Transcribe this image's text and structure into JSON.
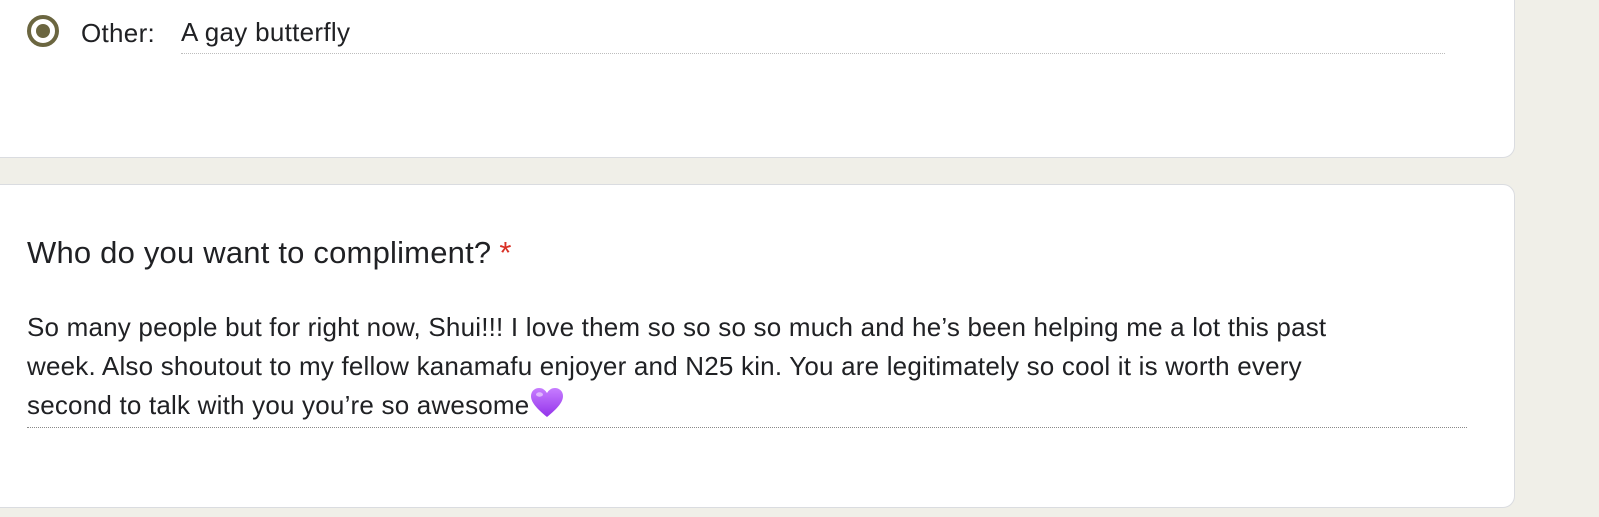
{
  "previous_question": {
    "option": {
      "label": "Other:",
      "value": "A gay butterfly",
      "selected": true
    }
  },
  "question": {
    "title": "Who do you want to compliment?",
    "required_marker": "*",
    "answer_text": "So many people but for right now, Shui!!! I love them so so so so much and he’s been helping me a lot this past\nweek. Also shoutout to my fellow kanamafu enjoyer and N25 kin. You are legitimately so cool it is worth every\nsecond to talk with you you’re so awesome",
    "answer_emoji": "purple-heart-icon"
  },
  "colors": {
    "background": "#f0efe8",
    "radio_accent": "#6b6640",
    "required": "#d93025",
    "heart": "#a855f7"
  }
}
